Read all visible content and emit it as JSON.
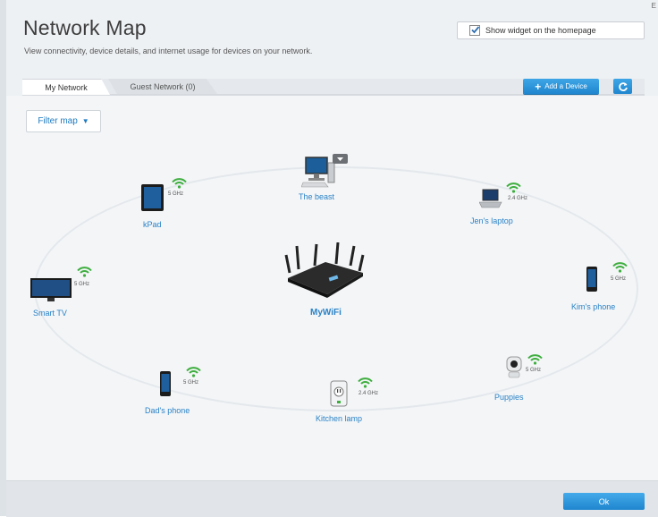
{
  "header": {
    "title": "Network Map",
    "description": "View connectivity, device details, and internet usage for devices on your network.",
    "corner_mark": "E"
  },
  "widget": {
    "label": "Show widget on the homepage",
    "checked": true
  },
  "tabs": [
    {
      "label": "My Network",
      "active": true
    },
    {
      "label": "Guest Network (0)",
      "active": false
    }
  ],
  "toolbar": {
    "add_device_label": "Add a Device",
    "refresh_icon": "refresh-icon"
  },
  "filter": {
    "label": "Filter map"
  },
  "router": {
    "name": "MyWiFi",
    "icon": "router-icon"
  },
  "devices": [
    {
      "name": "The beast",
      "band": "",
      "icon": "desktop-icon"
    },
    {
      "name": "Jen's laptop",
      "band": "2.4 GHz",
      "icon": "laptop-icon"
    },
    {
      "name": "Kim's phone",
      "band": "5 GHz",
      "icon": "phone-icon"
    },
    {
      "name": "Puppies",
      "band": "5 GHz",
      "icon": "camera-icon"
    },
    {
      "name": "Kitchen lamp",
      "band": "2.4 GHz",
      "icon": "smart-plug-icon"
    },
    {
      "name": "Dad's phone",
      "band": "5 GHz",
      "icon": "phone-icon"
    },
    {
      "name": "Smart TV",
      "band": "5 GHz",
      "icon": "tv-icon"
    },
    {
      "name": "kPad",
      "band": "5 GHz",
      "icon": "tablet-icon"
    }
  ],
  "footer": {
    "ok_label": "Ok"
  },
  "colors": {
    "accent": "#2a82c7",
    "button": "#1f86cf",
    "wifi": "#3fae3f"
  }
}
